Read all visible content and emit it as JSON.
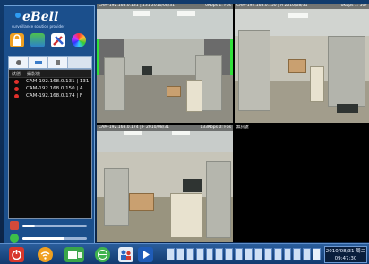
{
  "app": {
    "logo_text": "eBell",
    "logo_tagline": "surveillance solution provider"
  },
  "device_panel": {
    "columns": [
      "狀態",
      "攝影機"
    ],
    "cameras": [
      {
        "label": "CAM-192.168.0.131 | 131"
      },
      {
        "label": "CAM-192.168.0.150 | A"
      },
      {
        "label": "CAM-192.168.0.174 | F"
      }
    ]
  },
  "video": {
    "cells": [
      {
        "title": "CAM-192.168.0.131 | 131 2010/08/31",
        "rate": "0Kbps 1: Fps"
      },
      {
        "title": "CAM-192.168.0.150 | A 2010/08/31",
        "rate": "0Kbps 1: 50F"
      },
      {
        "title": "CAM-192.168.0.174 | F 2010/08/31",
        "rate": "133Kbps 0: Fps"
      },
      {
        "title": "無訊號",
        "rate": ""
      }
    ]
  },
  "clock": {
    "date": "2010/08/31 周二",
    "time": "09:47:30"
  },
  "colors": {
    "selected_border": "#31e03a",
    "status_dot": "#e0302b"
  }
}
